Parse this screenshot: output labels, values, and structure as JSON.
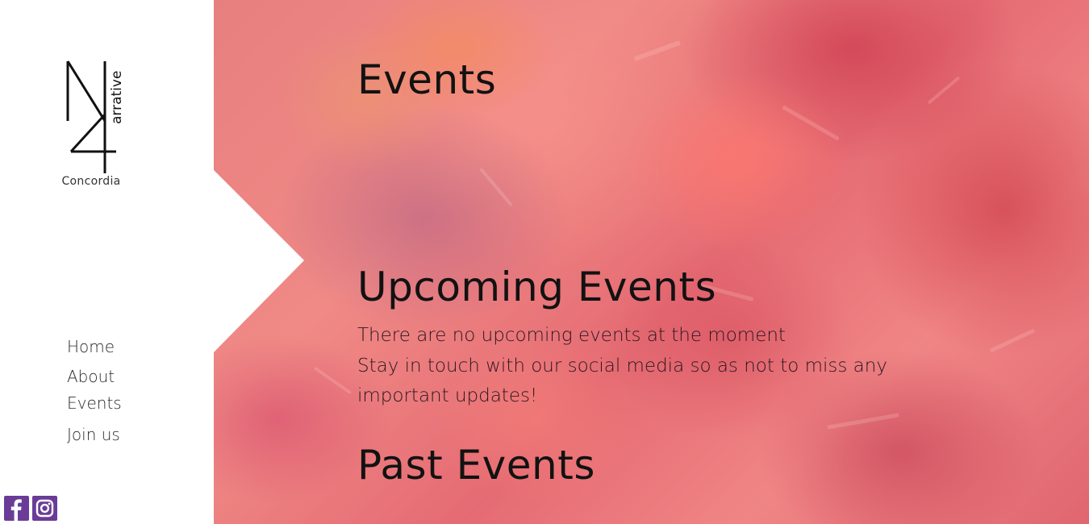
{
  "brand": {
    "logo_glyph": "N4",
    "logo_word": "arrative",
    "caption": "Concordia"
  },
  "nav": {
    "items": [
      {
        "label": "Home"
      },
      {
        "label": "About"
      },
      {
        "label": "Events"
      },
      {
        "label": "Join us"
      }
    ]
  },
  "social": {
    "facebook_icon": "facebook-icon",
    "instagram_icon": "instagram-icon",
    "color": "#6a3c98"
  },
  "main": {
    "page_title": "Events",
    "upcoming": {
      "title": "Upcoming Events",
      "line1": "There are no upcoming events at the moment",
      "line2": "Stay in touch with our social media so as not to miss any important updates!"
    },
    "past": {
      "title": "Past Events"
    }
  },
  "colors": {
    "background_accent": "#e77f7f",
    "text": "#121212"
  }
}
